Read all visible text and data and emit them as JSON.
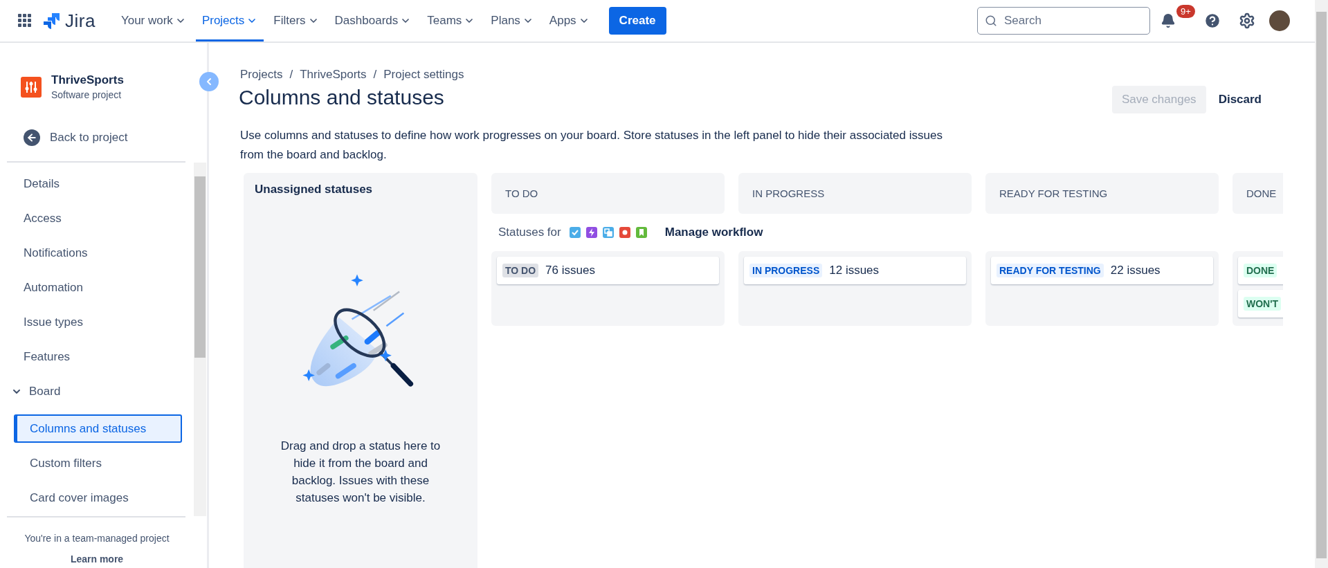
{
  "topbar": {
    "product": "Jira",
    "nav": [
      {
        "label": "Your work",
        "selected": false
      },
      {
        "label": "Projects",
        "selected": true
      },
      {
        "label": "Filters",
        "selected": false
      },
      {
        "label": "Dashboards",
        "selected": false
      },
      {
        "label": "Teams",
        "selected": false
      },
      {
        "label": "Plans",
        "selected": false
      },
      {
        "label": "Apps",
        "selected": false
      }
    ],
    "create": "Create",
    "search": {
      "placeholder": "Search"
    },
    "notifications_badge": "9+"
  },
  "sidebar": {
    "project": {
      "name": "ThriveSports",
      "type": "Software project"
    },
    "back": "Back to project",
    "items": [
      {
        "label": "Details",
        "selected": false
      },
      {
        "label": "Access",
        "selected": false
      },
      {
        "label": "Notifications",
        "selected": false
      },
      {
        "label": "Automation",
        "selected": false
      },
      {
        "label": "Issue types",
        "selected": false
      },
      {
        "label": "Features",
        "selected": false
      },
      {
        "label": "Board",
        "selected": false,
        "expanded": true,
        "children": [
          {
            "label": "Columns and statuses",
            "selected": true
          },
          {
            "label": "Custom filters",
            "selected": false
          },
          {
            "label": "Card cover images",
            "selected": false
          }
        ]
      }
    ],
    "footer": {
      "note": "You're in a team-managed project",
      "link": "Learn more"
    }
  },
  "breadcrumbs": {
    "separator": "/",
    "items": [
      "Projects",
      "ThriveSports",
      "Project settings"
    ]
  },
  "title": "Columns and statuses",
  "actions": {
    "save": {
      "label": "Save changes",
      "disabled": true
    },
    "discard": "Discard"
  },
  "description": "Use columns and statuses to define how work progresses on your board. Store statuses in the left panel to hide their associated issues from the board and backlog.",
  "unassigned": {
    "title": "Unassigned statuses",
    "hint": "Drag and drop a status here to hide it from the board and backlog. Issues with these statuses won't be visible."
  },
  "statuses_for": {
    "label": "Statuses for",
    "link": "Manage workflow"
  },
  "columns": [
    {
      "name": "TO DO",
      "statuses": [
        {
          "label": "TO DO",
          "kind": "todo",
          "count": "76 issues"
        }
      ]
    },
    {
      "name": "IN PROGRESS",
      "statuses": [
        {
          "label": "IN PROGRESS",
          "kind": "inprogress",
          "count": "12 issues"
        }
      ]
    },
    {
      "name": "READY FOR TESTING",
      "statuses": [
        {
          "label": "READY FOR TESTING",
          "kind": "inprogress",
          "count": "22 issues"
        }
      ]
    },
    {
      "name": "DONE",
      "statuses": [
        {
          "label": "DONE",
          "kind": "done"
        },
        {
          "label": "WON'T",
          "kind": "done"
        }
      ]
    }
  ]
}
